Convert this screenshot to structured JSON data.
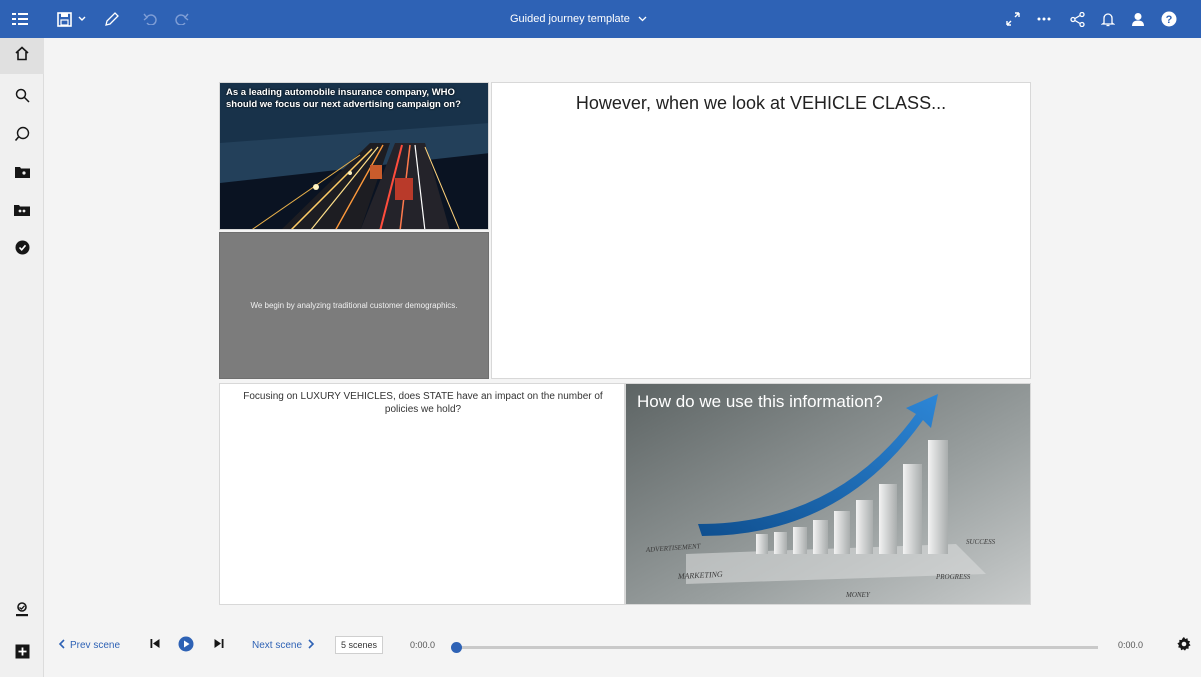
{
  "header": {
    "title": "Guided journey template",
    "icons": [
      "menu-icon",
      "save-icon",
      "chevron-down-icon",
      "edit-icon",
      "undo-icon",
      "redo-icon",
      "expand-icon",
      "more-icon",
      "share-icon",
      "notification-icon",
      "user-icon",
      "help-icon"
    ]
  },
  "sidebar": {
    "items": [
      {
        "icon": "home-icon"
      },
      {
        "icon": "search-icon"
      },
      {
        "icon": "assistant-icon"
      },
      {
        "icon": "folder-icon"
      },
      {
        "icon": "team-folder-icon"
      },
      {
        "icon": "check-circle-icon"
      }
    ],
    "bottom_items": [
      {
        "icon": "user-badge-icon"
      },
      {
        "icon": "add-icon"
      }
    ]
  },
  "panels": {
    "photo_caption": "As a leading automobile insurance company, WHO should we focus our next advertising campaign on?",
    "grey_text": "We begin by analyzing traditional customer demographics.",
    "vehicle_heading": "However, when we look at VEHICLE CLASS...",
    "luxury_text": "Focusing on LUXURY VEHICLES, does STATE have an impact on the number of policies we hold?",
    "chart_heading": "How do we use this information?",
    "chart_image_labels": [
      "ADVERTISEMENT",
      "MARKETING",
      "MONEY",
      "PROGRESS",
      "SUCCESS"
    ]
  },
  "playback": {
    "prev_label": "Prev scene",
    "next_label": "Next scene",
    "scenes_count": "5 scenes",
    "time_start": "0:00.0",
    "time_end": "0:00.0",
    "progress": 0
  },
  "colors": {
    "accent": "#2e62b5",
    "topbar": "#2e62b5",
    "grey_panel": "#7c7c7c"
  }
}
